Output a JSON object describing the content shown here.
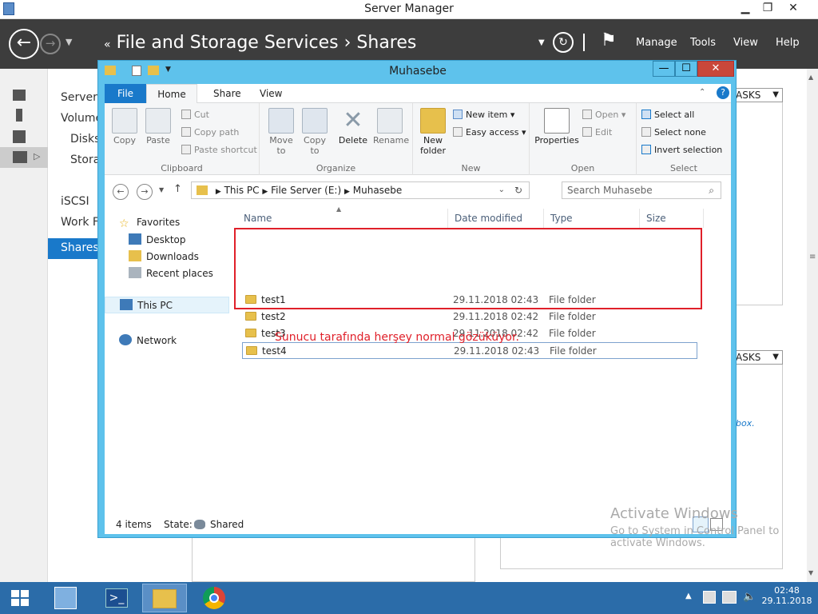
{
  "server_manager": {
    "title": "Server Manager",
    "breadcrumb_root": "File and Storage Services",
    "breadcrumb_sep": "›",
    "breadcrumb_leaf": "Shares",
    "back_glyph": "←",
    "forward_glyph": "→",
    "header_menu": [
      "Manage",
      "Tools",
      "View",
      "Help"
    ],
    "nav": [
      "Servers",
      "Volume",
      "Disks",
      "Storag",
      "Shares",
      "iSCSI",
      "Work Fo"
    ],
    "tasks_label": "ASKS",
    "panel_text": "box.",
    "win_min": "▁",
    "win_max": "❐",
    "win_close": "✕"
  },
  "explorer": {
    "title": "Muhasebe",
    "win_min": "—",
    "win_max": "☐",
    "win_close": "✕",
    "tabs": {
      "file": "File",
      "home": "Home",
      "share": "Share",
      "view": "View"
    },
    "ribbon": {
      "clipboard": {
        "label": "Clipboard",
        "copy": "Copy",
        "paste": "Paste",
        "cut": "Cut",
        "copy_path": "Copy path",
        "paste_shortcut": "Paste shortcut"
      },
      "organize": {
        "label": "Organize",
        "move_to": "Move to",
        "copy_to": "Copy to",
        "delete": "Delete",
        "rename": "Rename"
      },
      "new": {
        "label": "New",
        "new_folder": "New folder",
        "new_item": "New item",
        "easy_access": "Easy access"
      },
      "open": {
        "label": "Open",
        "properties": "Properties",
        "open": "Open",
        "edit": "Edit"
      },
      "select": {
        "label": "Select",
        "select_all": "Select all",
        "select_none": "Select none",
        "invert": "Invert selection"
      }
    },
    "address": {
      "this_pc": "This PC",
      "drive": "File Server (E:)",
      "folder": "Muhasebe"
    },
    "search_placeholder": "Search Muhasebe",
    "tree": {
      "favorites": "Favorites",
      "desktop": "Desktop",
      "downloads": "Downloads",
      "recent": "Recent places",
      "this_pc": "This PC",
      "network": "Network"
    },
    "columns": {
      "name": "Name",
      "date": "Date modified",
      "type": "Type",
      "size": "Size"
    },
    "files": [
      {
        "name": "test1",
        "date": "29.11.2018 02:43",
        "type": "File folder"
      },
      {
        "name": "test2",
        "date": "29.11.2018 02:42",
        "type": "File folder"
      },
      {
        "name": "test3",
        "date": "29.11.2018 02:42",
        "type": "File folder"
      },
      {
        "name": "test4",
        "date": "29.11.2018 02:43",
        "type": "File folder"
      }
    ],
    "annotation": "Sunucu tarafında herşey normal gözüküyor.",
    "status": {
      "count": "4 items",
      "state_label": "State:",
      "state_value": "Shared"
    }
  },
  "watermark": {
    "line1": "Activate Windows",
    "line2": "Go to System in Control Panel to",
    "line3": "activate Windows."
  },
  "taskbar": {
    "time": "02:48",
    "date": "29.11.2018"
  },
  "colors": {
    "accent": "#1979ca",
    "header_bg": "#3d3d3d",
    "explorer_frame": "#5ec2ec",
    "taskbar": "#2b6ca9",
    "annotation": "#e0202a"
  }
}
